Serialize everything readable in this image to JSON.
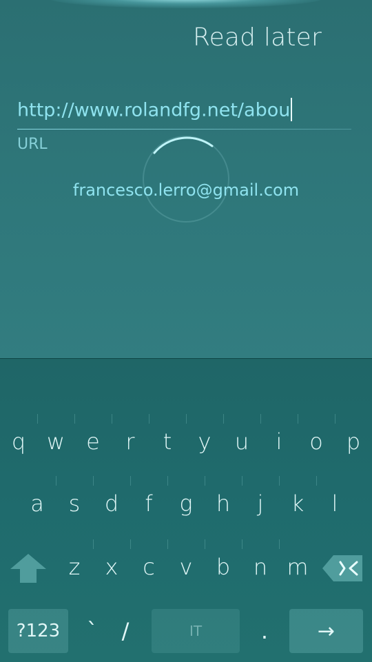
{
  "header": {
    "title": "Read later"
  },
  "url_field": {
    "value": "http://www.rolandfg.net/abou",
    "label": "URL"
  },
  "account": {
    "email": "francesco.lerro@gmail.com"
  },
  "keyboard": {
    "row1": [
      "q",
      "w",
      "e",
      "r",
      "t",
      "y",
      "u",
      "i",
      "o",
      "p"
    ],
    "row2": [
      "a",
      "s",
      "d",
      "f",
      "g",
      "h",
      "j",
      "k",
      "l"
    ],
    "row3": [
      "z",
      "x",
      "c",
      "v",
      "b",
      "n",
      "m"
    ],
    "symbols_label": "?123",
    "backtick": "`",
    "slash": "/",
    "space_label": "IT",
    "period": ".",
    "enter_label": "→",
    "shift_icon": "shift-arrow-icon",
    "backspace_icon": "backspace-icon"
  },
  "colors": {
    "accent": "#8fe3ef",
    "background": "#2f787b",
    "keyboard_bg": "#1f6b6d"
  }
}
